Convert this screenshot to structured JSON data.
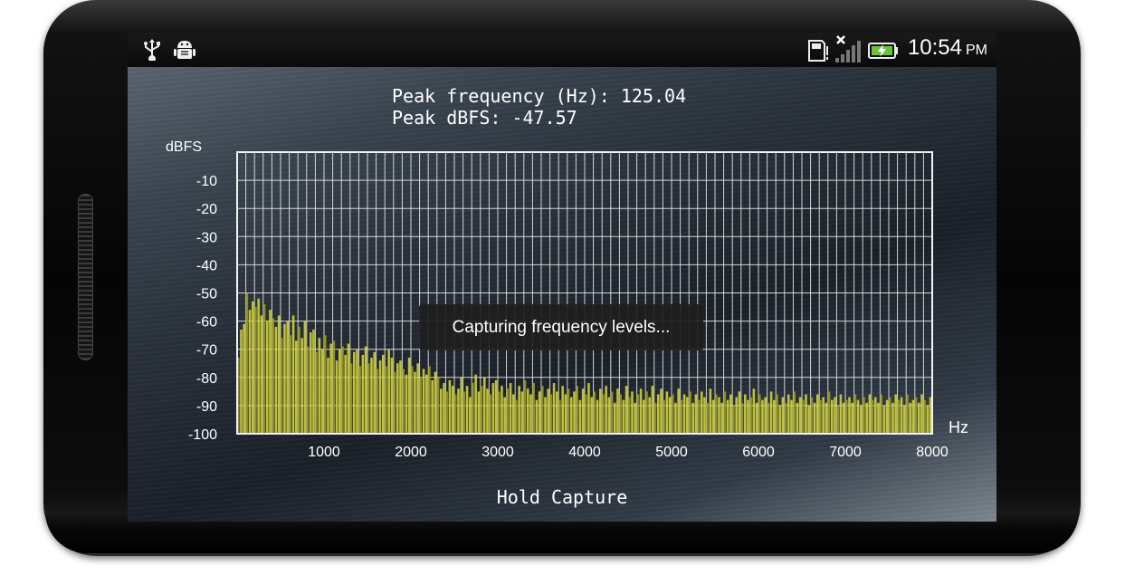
{
  "status_bar": {
    "icons": [
      "usb-icon",
      "android-debug-icon",
      "sd-card-alert-icon",
      "no-signal-icon",
      "battery-charging-icon"
    ],
    "time": "10:54",
    "ampm": "PM"
  },
  "readout": {
    "peak_frequency": "Peak frequency (Hz): 125.04",
    "peak_dbfs": "Peak dBFS: -47.57"
  },
  "toast": "Capturing frequency levels...",
  "hold_button": "Hold Capture",
  "colors": {
    "bars": "#d2d23a",
    "grid": "#e6e6e6"
  },
  "chart_data": {
    "type": "bar",
    "ylabel": "dBFS",
    "xlabel": "Hz",
    "ylim": [
      -100,
      0
    ],
    "xlim": [
      0,
      8000
    ],
    "yticks": [
      "-10",
      "-20",
      "-30",
      "-40",
      "-50",
      "-60",
      "-70",
      "-80",
      "-90",
      "-100"
    ],
    "xticks": [
      "1000",
      "2000",
      "3000",
      "4000",
      "5000",
      "6000",
      "7000",
      "8000"
    ],
    "grid": true,
    "values": [
      -73,
      -63,
      -61,
      -50,
      -56,
      -53,
      -55,
      -52,
      -58,
      -54,
      -60,
      -56,
      -59,
      -62,
      -58,
      -66,
      -61,
      -60,
      -65,
      -58,
      -67,
      -62,
      -66,
      -60,
      -69,
      -64,
      -63,
      -71,
      -66,
      -70,
      -65,
      -73,
      -68,
      -67,
      -74,
      -70,
      -69,
      -72,
      -68,
      -75,
      -71,
      -70,
      -76,
      -72,
      -69,
      -75,
      -73,
      -71,
      -77,
      -74,
      -72,
      -76,
      -70,
      -73,
      -78,
      -75,
      -74,
      -77,
      -79,
      -73,
      -76,
      -78,
      -75,
      -80,
      -77,
      -79,
      -76,
      -81,
      -78,
      -80,
      -84,
      -82,
      -85,
      -81,
      -83,
      -86,
      -84,
      -80,
      -85,
      -83,
      -87,
      -82,
      -79,
      -85,
      -83,
      -80,
      -84,
      -86,
      -82,
      -81,
      -85,
      -83,
      -87,
      -84,
      -82,
      -86,
      -88,
      -83,
      -85,
      -81,
      -84,
      -86,
      -82,
      -88,
      -85,
      -83,
      -87,
      -84,
      -86,
      -82,
      -85,
      -88,
      -83,
      -86,
      -84,
      -87,
      -85,
      -83,
      -88,
      -84,
      -86,
      -82,
      -87,
      -85,
      -88,
      -84,
      -86,
      -83,
      -87,
      -85,
      -89,
      -84,
      -86,
      -88,
      -83,
      -87,
      -85,
      -89,
      -86,
      -84,
      -88,
      -85,
      -87,
      -83,
      -89,
      -86,
      -84,
      -88,
      -85,
      -87,
      -86,
      -89,
      -84,
      -88,
      -86,
      -87,
      -85,
      -89,
      -86,
      -88,
      -85,
      -87,
      -89,
      -84,
      -88,
      -86,
      -87,
      -89,
      -85,
      -88,
      -86,
      -90,
      -87,
      -85,
      -89,
      -86,
      -88,
      -87,
      -84,
      -89,
      -86,
      -88,
      -87,
      -89,
      -85,
      -88,
      -86,
      -90,
      -87,
      -89,
      -86,
      -88,
      -85,
      -89,
      -87,
      -88,
      -86,
      -90,
      -87,
      -89,
      -86,
      -88,
      -87,
      -89,
      -85,
      -88,
      -87,
      -90,
      -86,
      -89,
      -88,
      -87,
      -89,
      -86,
      -88,
      -90,
      -87,
      -89,
      -86,
      -88,
      -87,
      -89,
      -86,
      -90,
      -88,
      -87,
      -89,
      -86,
      -88,
      -87,
      -90,
      -86,
      -89,
      -88,
      -87,
      -89,
      -86,
      -88,
      -90,
      -87
    ]
  }
}
